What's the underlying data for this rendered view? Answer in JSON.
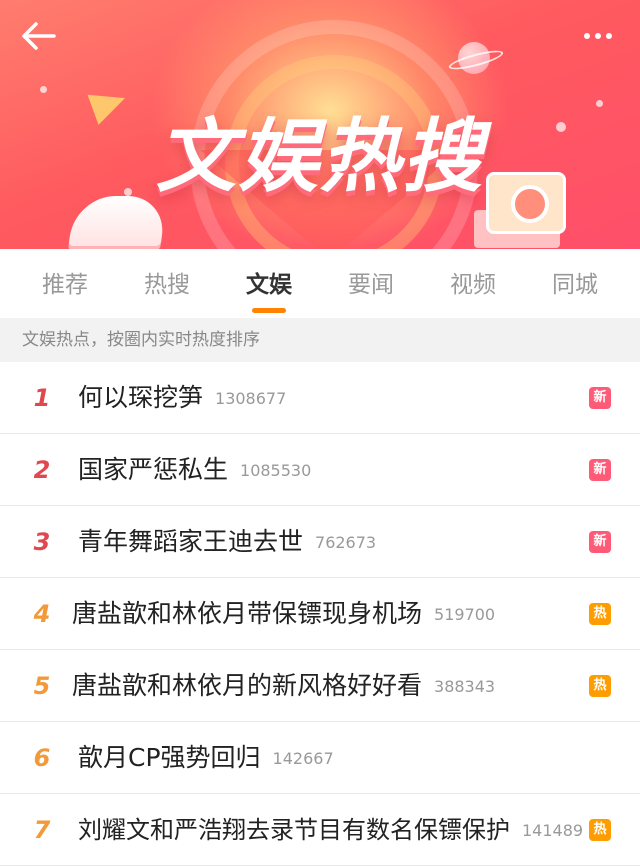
{
  "header": {
    "title": "文娱热搜"
  },
  "tabs": [
    {
      "label": "推荐",
      "active": false
    },
    {
      "label": "热搜",
      "active": false
    },
    {
      "label": "文娱",
      "active": true
    },
    {
      "label": "要闻",
      "active": false
    },
    {
      "label": "视频",
      "active": false
    },
    {
      "label": "同城",
      "active": false
    }
  ],
  "subtitle": "文娱热点，按圈内实时热度排序",
  "list": [
    {
      "rank": "1",
      "topic": "何以琛挖笋",
      "count": "1308677",
      "badge": "新",
      "badge_type": "new"
    },
    {
      "rank": "2",
      "topic": "国家严惩私生",
      "count": "1085530",
      "badge": "新",
      "badge_type": "new"
    },
    {
      "rank": "3",
      "topic": "青年舞蹈家王迪去世",
      "count": "762673",
      "badge": "新",
      "badge_type": "new"
    },
    {
      "rank": "4",
      "topic": "唐盐歆和林依月带保镖现身机场",
      "count": "519700",
      "badge": "热",
      "badge_type": "hot"
    },
    {
      "rank": "5",
      "topic": "唐盐歆和林依月的新风格好好看",
      "count": "388343",
      "badge": "热",
      "badge_type": "hot"
    },
    {
      "rank": "6",
      "topic": "歆月CP强势回归",
      "count": "142667",
      "badge": "",
      "badge_type": "none"
    },
    {
      "rank": "7",
      "topic": "刘耀文和严浩翔去录节目有数名保镖保护",
      "count": "141489",
      "badge": "热",
      "badge_type": "hot"
    }
  ],
  "colors": {
    "accent": "#ff8200",
    "rank_top": "#e0484f",
    "rank_normal": "#f29a3a",
    "badge_new": "#ff5a78",
    "badge_hot": "#ff9d00"
  },
  "icons": {
    "back": "back-arrow-icon",
    "more": "more-dots-icon"
  }
}
